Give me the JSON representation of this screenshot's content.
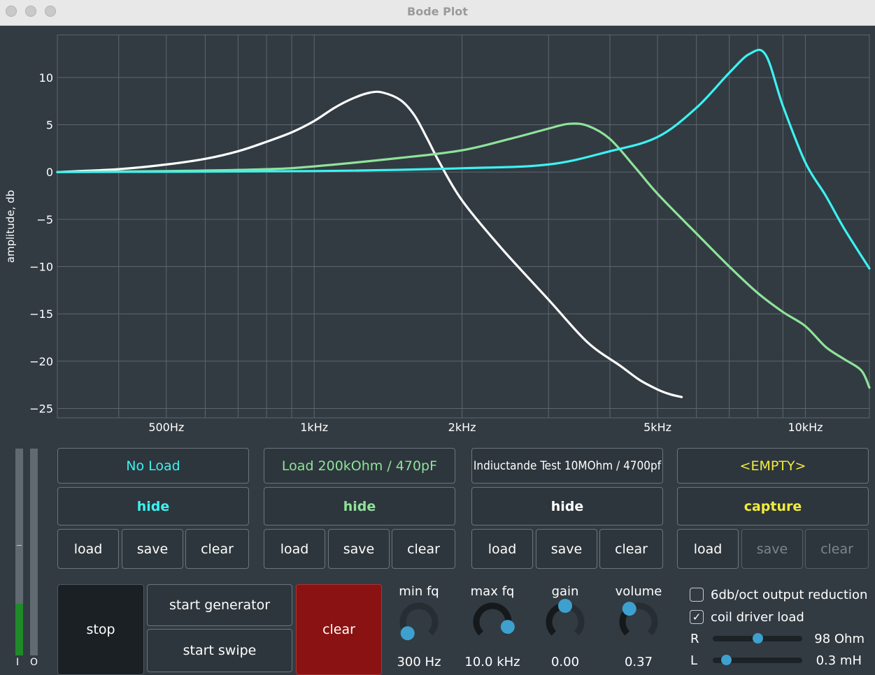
{
  "window": {
    "title": "Bode Plot"
  },
  "chart_data": {
    "type": "line",
    "ylabel": "amplitude, db",
    "xscale": "log",
    "xlim": [
      300,
      13500
    ],
    "ylim": [
      -26,
      14.5
    ],
    "yticks": [
      10,
      5,
      0,
      -5,
      -10,
      -15,
      -20,
      -25
    ],
    "ytick_labels": [
      "10",
      "5",
      "0",
      "−5",
      "−10",
      "−15",
      "−20",
      "−25"
    ],
    "xticks": [
      500,
      1000,
      2000,
      5000,
      10000
    ],
    "xtick_labels": [
      "500Hz",
      "1kHz",
      "2kHz",
      "5kHz",
      "10kHz"
    ],
    "grid": true,
    "series": [
      {
        "name": "No Load",
        "color": "#ffffff",
        "points": [
          [
            300,
            0
          ],
          [
            400,
            0.3
          ],
          [
            500,
            0.8
          ],
          [
            600,
            1.4
          ],
          [
            700,
            2.2
          ],
          [
            800,
            3.2
          ],
          [
            900,
            4.2
          ],
          [
            1000,
            5.4
          ],
          [
            1100,
            6.8
          ],
          [
            1200,
            7.8
          ],
          [
            1300,
            8.4
          ],
          [
            1380,
            8.4
          ],
          [
            1500,
            7.6
          ],
          [
            1600,
            6
          ],
          [
            1700,
            3.5
          ],
          [
            1800,
            1
          ],
          [
            2000,
            -3
          ],
          [
            2400,
            -8
          ],
          [
            3000,
            -13.5
          ],
          [
            3600,
            -18
          ],
          [
            4200,
            -20.5
          ],
          [
            4600,
            -22
          ],
          [
            5000,
            -23
          ],
          [
            5300,
            -23.5
          ],
          [
            5600,
            -23.8
          ]
        ]
      },
      {
        "name": "Load 200kOhm / 470pF",
        "color": "#8fe39a",
        "points": [
          [
            300,
            0
          ],
          [
            500,
            0.1
          ],
          [
            800,
            0.3
          ],
          [
            1000,
            0.6
          ],
          [
            1500,
            1.5
          ],
          [
            2000,
            2.3
          ],
          [
            2500,
            3.5
          ],
          [
            3000,
            4.6
          ],
          [
            3300,
            5.1
          ],
          [
            3600,
            4.9
          ],
          [
            4000,
            3.5
          ],
          [
            4500,
            0.5
          ],
          [
            5000,
            -2.3
          ],
          [
            6000,
            -6.5
          ],
          [
            7000,
            -10
          ],
          [
            8000,
            -12.8
          ],
          [
            9000,
            -14.8
          ],
          [
            10000,
            -16.3
          ],
          [
            11000,
            -18.5
          ],
          [
            12000,
            -19.8
          ],
          [
            13000,
            -21
          ],
          [
            13500,
            -22.8
          ]
        ]
      },
      {
        "name": "Indiuctande Test 10MOhm / 4700pf",
        "color": "#3cf2f2",
        "points": [
          [
            300,
            0
          ],
          [
            1000,
            0.1
          ],
          [
            2000,
            0.4
          ],
          [
            3000,
            0.8
          ],
          [
            4000,
            2.2
          ],
          [
            5000,
            3.7
          ],
          [
            6000,
            6.8
          ],
          [
            7000,
            10.5
          ],
          [
            7700,
            12.5
          ],
          [
            8300,
            12.4
          ],
          [
            9000,
            7
          ],
          [
            10000,
            1
          ],
          [
            11000,
            -2.5
          ],
          [
            12000,
            -6
          ],
          [
            13500,
            -10.2
          ]
        ]
      }
    ]
  },
  "slots": [
    {
      "title": "No Load",
      "title_color": "#3cf2f2",
      "action": "hide",
      "action_color": "#3cf2f2",
      "load": "load",
      "save": "save",
      "clear": "clear"
    },
    {
      "title": "Load 200kOhm / 470pF",
      "title_color": "#8fe39a",
      "action": "hide",
      "action_color": "#8fe39a",
      "load": "load",
      "save": "save",
      "clear": "clear"
    },
    {
      "title": "Indiuctande Test 10MOhm / 4700pf",
      "title_color": "#ffffff",
      "action": "hide",
      "action_color": "#ffffff",
      "load": "load",
      "save": "save",
      "clear": "clear"
    },
    {
      "title": "<EMPTY>",
      "title_color": "#f2ec3c",
      "action": "capture",
      "action_color": "#f2ec3c",
      "load": "load",
      "save": "save",
      "clear": "clear",
      "disabled": true
    }
  ],
  "meters": {
    "in_label": "I",
    "out_label": "O",
    "in_level": 0.25,
    "out_level": 0.0
  },
  "controls": {
    "stop": "stop",
    "start_generator": "start generator",
    "start_swipe": "start swipe",
    "clear": "clear"
  },
  "knobs": [
    {
      "label": "min fq",
      "value": "300 Hz",
      "level": 0.0
    },
    {
      "label": "max fq",
      "value": "10.0 kHz",
      "level": 0.9
    },
    {
      "label": "gain",
      "value": "0.00",
      "level": 0.5
    },
    {
      "label": "volume",
      "value": "0.37",
      "level": 0.37
    }
  ],
  "options": {
    "output_reduction": {
      "label": "6db/oct output reduction",
      "checked": false
    },
    "coil_driver": {
      "label": "coil driver load",
      "checked": true
    }
  },
  "sliders": [
    {
      "label": "R",
      "value": "98 Ohm",
      "level": 0.5
    },
    {
      "label": "L",
      "value": "0.3 mH",
      "level": 0.15
    }
  ],
  "colors": {
    "accent": "#3ea0cf",
    "clear_button": "#8b1212",
    "stop_button": "#1b2024"
  }
}
